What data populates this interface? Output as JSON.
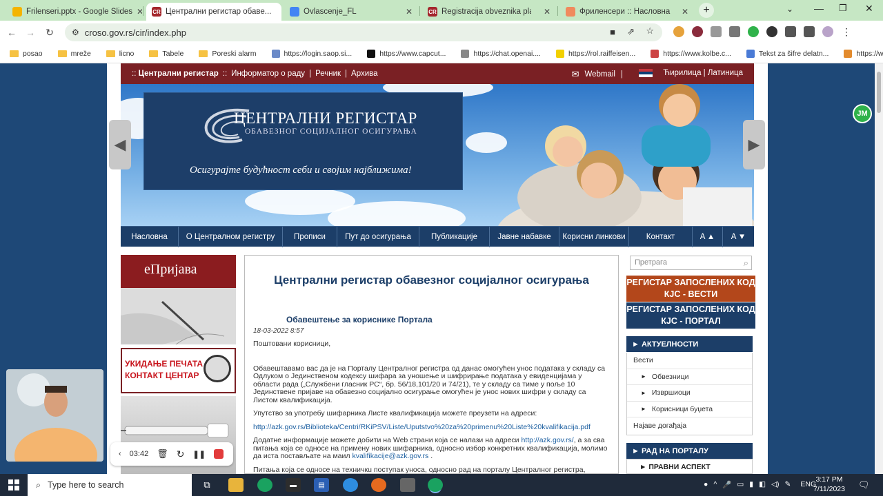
{
  "browser": {
    "tabs": [
      {
        "title": "Frilenseri.pptx - Google Slides",
        "icon": "slides-icon",
        "active": false
      },
      {
        "title": "Централни регистар обаве...",
        "icon": "cr-icon",
        "active": true
      },
      {
        "title": "Ovlascenje_FL",
        "icon": "docs-icon",
        "active": false
      },
      {
        "title": "Registracija obveznika plaćanja",
        "icon": "cr-icon",
        "active": false
      },
      {
        "title": "Фриленсери :: Насловна",
        "icon": "orange-icon",
        "active": false
      }
    ],
    "new_tab": "+",
    "url": "croso.gov.rs/cir/index.php",
    "bookmarks": [
      "posao",
      "mreže",
      "licno",
      "Tabele",
      "Poreski alarm",
      "https://login.saop.si...",
      "https://www.capcut...",
      "https://chat.openai....",
      "https://rol.raiffeisen...",
      "https://www.kolbe.c...",
      "Tekst za šifre delatn...",
      "https://www.donaci..."
    ]
  },
  "site": {
    "topnav": {
      "items": [
        "Централни регистар",
        "Информатор о раду",
        "Речник",
        "Архива"
      ],
      "webmail": "Webmail",
      "lang_cyr": "Ћирилица",
      "lang_lat": "Латиница"
    },
    "banner": {
      "title": "ЦЕНТРАЛНИ РЕГИСТАР",
      "subtitle": "ОБАВЕЗНОГ СОЦИЈАЛНОГ ОСИГУРАЊА",
      "slogan": "Осигурајте будућност себи и својим најближима!"
    },
    "mainnav": [
      "Насловна",
      "О Централном регистру",
      "Прописи",
      "Пут до осигурања",
      "Публикације",
      "Јавне набавке",
      "Корисни линкови",
      "Контакт",
      "A ▲",
      "A ▼"
    ],
    "left": {
      "eprijava": "еПријава",
      "stamp_line1": "УКИДАЊЕ ПЕЧАТА",
      "stamp_line2": "КОНТАКТ ЦЕНТАР"
    },
    "content": {
      "heading": "Централни регистар обавезног социјалног осигурања",
      "notice_title": "Обавештење за кориснике Портала",
      "date": "18-03-2022 8:57",
      "greeting": "Поштовани корисници,",
      "p1": "Обавештавамо вас да је на Порталу Централног регистра од данас омогућен унос података у складу са Одлуком о Јединственом кодексу шифара за уношење и шифрирање података у евиденцијама у области рада („Службени гласник РС“, бр. 56/18,101/20 и 74/21), те у складу са тиме у поље 10 Јединствене пријаве на обавезно социјално осигурање омогућен је унос нових шифри у складу са Листом квалификација.",
      "p2": "Упутство за употребу шифарника Листе квалификација можете преузети на адреси:",
      "link1": "http://azk.gov.rs/Biblioteka/Centri/RKiPSV/Liste/Uputstvo%20za%20primenu%20Liste%20kvalifikacija.pdf",
      "p3_a": "Додатне информације можете добити на Web страни која се налази на адреси",
      "link2": "http://azk.gov.rs/",
      "p3_b": ", а за сва питања која се односе на примену нових шифарника, односно избор конкретних квалификација, молимо да иста постављате на маил",
      "link3": "kvalifikacije@azk.gov.rs",
      "p3_c": ".",
      "p4": "Питања која се односе на техничкu поступак уноса, односно рад на порталу Централног регистра, можете"
    },
    "right": {
      "search_placeholder": "Претрага",
      "btn1": "РЕГИСТАР ЗАПОСЛЕНИХ КОД КЈС - ВЕСТИ",
      "btn2": "РЕГИСТАР ЗАПОСЛЕНИХ КОД КЈС - ПОРТАЛ",
      "news_header": "АКТУЕЛНОСТИ",
      "news_items": [
        "Вести",
        "Обвезници",
        "Извршиоци",
        "Корисници буџета",
        "Најаве догађаја"
      ],
      "portal_header": "РАД НА ПОРТАЛУ",
      "portal_item": "ПРАВНИ АСПЕКТ"
    }
  },
  "recorder": {
    "time": "03:42"
  },
  "sidebar_badge": "JM",
  "taskbar": {
    "search_placeholder": "Type here to search",
    "lang": "ENG",
    "time": "3:17 PM",
    "date": "7/11/2023"
  },
  "colors": {
    "maroon": "#7a2024",
    "navy": "#1c3e68",
    "orange_btn": "#b3471b",
    "page_bg": "#1e4877"
  }
}
